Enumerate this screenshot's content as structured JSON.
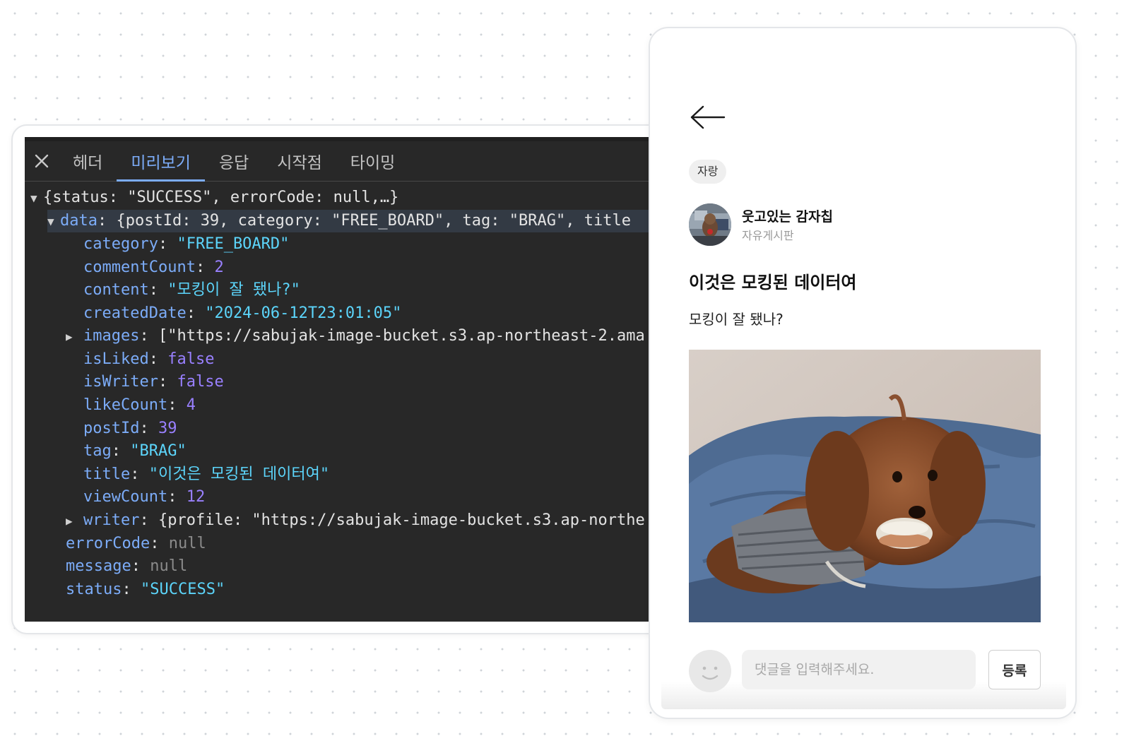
{
  "devtools": {
    "tabs": [
      {
        "label": "헤더"
      },
      {
        "label": "미리보기",
        "active": true
      },
      {
        "label": "응답"
      },
      {
        "label": "시작점"
      },
      {
        "label": "타이밍"
      }
    ],
    "tree": {
      "root_summary": "{status: \"SUCCESS\", errorCode: null,…}",
      "data_summary": "{postId: 39, category: \"FREE_BOARD\", tag: \"BRAG\", title",
      "category": "\"FREE_BOARD\"",
      "commentCount": "2",
      "content": "\"모킹이 잘 됐나?\"",
      "createdDate": "\"2024-06-12T23:01:05\"",
      "images_summary": "[\"https://sabujak-image-bucket.s3.ap-northeast-2.ama",
      "isLiked": "false",
      "isWriter": "false",
      "likeCount": "4",
      "postId": "39",
      "tag": "\"BRAG\"",
      "title": "\"이것은 모킹된 데이터여\"",
      "viewCount": "12",
      "writer_summary": "{profile: \"https://sabujak-image-bucket.s3.ap-northe",
      "errorCode": "null",
      "message": "null",
      "status": "\"SUCCESS\""
    },
    "keys": {
      "data": "data",
      "category": "category",
      "commentCount": "commentCount",
      "content": "content",
      "createdDate": "createdDate",
      "images": "images",
      "isLiked": "isLiked",
      "isWriter": "isWriter",
      "likeCount": "likeCount",
      "postId": "postId",
      "tag": "tag",
      "title": "title",
      "viewCount": "viewCount",
      "writer": "writer",
      "errorCode": "errorCode",
      "message": "message",
      "status": "status"
    }
  },
  "post": {
    "tag_label": "자랑",
    "writer_name": "웃고있는 감자칩",
    "board_name": "자유게시판",
    "title": "이것은 모킹된 데이터여",
    "content": "모킹이 잘 됐나?"
  },
  "comment": {
    "placeholder": "댓글을 입력해주세요.",
    "submit_label": "등록"
  },
  "icons": {
    "close": "close-icon",
    "back": "arrow-left-icon",
    "expand": "triangle-icon",
    "avatar_placeholder": "smiley-avatar-icon"
  },
  "colors": {
    "devtools_bg": "#282828",
    "key": "#7cacf8",
    "string": "#5cd5fb",
    "number": "#9980ff",
    "null": "#8b8b8b",
    "active_tab": "#7cacf8"
  }
}
